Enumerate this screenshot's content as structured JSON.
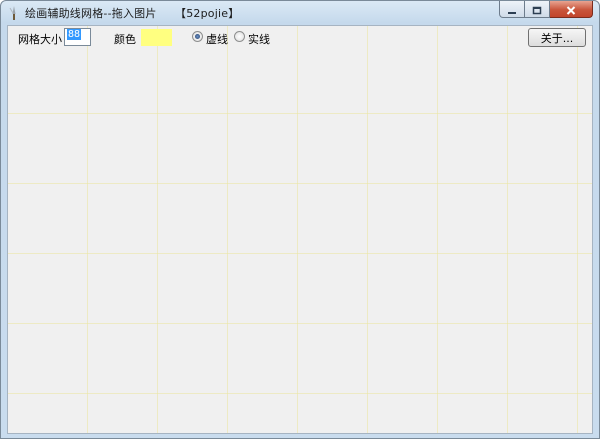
{
  "window": {
    "title": "绘画辅助线网格--拖入图片     【52pojie】"
  },
  "toolbar": {
    "grid_size_label": "网格大小",
    "grid_size_value": "88",
    "color_label": "颜色",
    "color_value": "#ffff80",
    "dashed_label": "虚线",
    "solid_label": "实线",
    "selected_line_style": "dashed",
    "about_label": "关于..."
  },
  "icons": {
    "app": "brush-icon",
    "minimize": "minimize-icon",
    "maximize": "maximize-icon",
    "close": "close-icon"
  },
  "colors": {
    "grid_line": "#ebe6a0",
    "client_bg": "#f0f0f0",
    "close_button": "#c9553b"
  }
}
